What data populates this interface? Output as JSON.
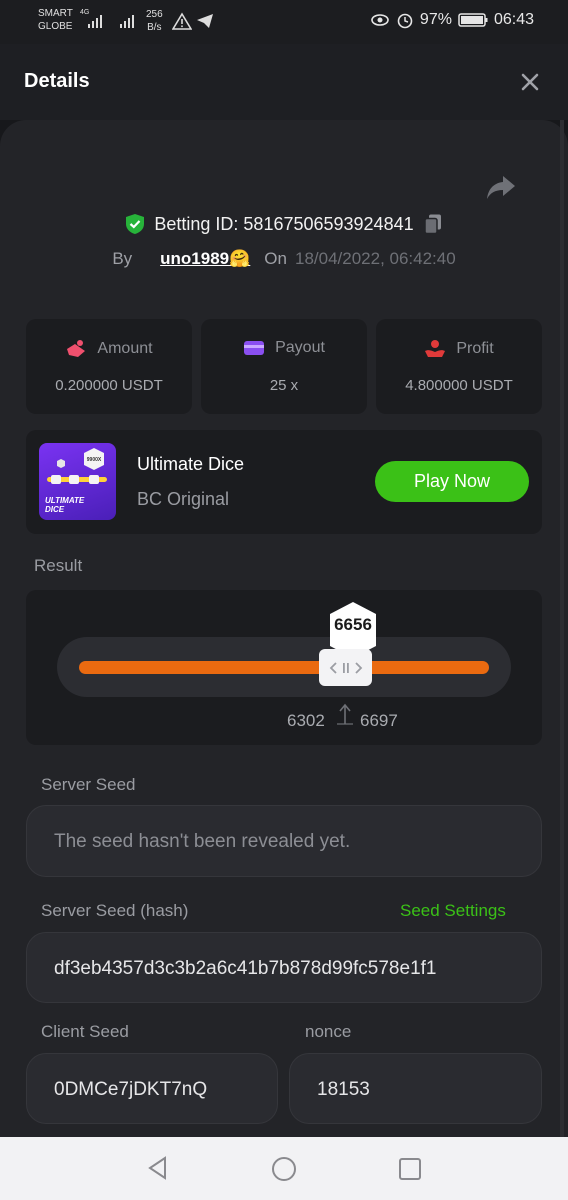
{
  "status_bar": {
    "carrier_line1": "SMART",
    "carrier_line2": "GLOBE",
    "network": "4G",
    "speed_value": "256",
    "speed_unit": "B/s",
    "battery": "97%",
    "time": "06:43"
  },
  "header": {
    "title": "Details"
  },
  "bet": {
    "betting_id_label": "Betting ID: 58167506593924841",
    "by_label": "By",
    "username": "uno1989🤗",
    "on_label": "On",
    "datetime": "18/04/2022, 06:42:40"
  },
  "stats": [
    {
      "label": "Amount",
      "value": "0.200000 USDT",
      "icon": "amount-icon"
    },
    {
      "label": "Payout",
      "value": "25 x",
      "icon": "wallet-icon"
    },
    {
      "label": "Profit",
      "value": "4.800000 USDT",
      "icon": "profit-icon"
    }
  ],
  "game": {
    "name": "Ultimate Dice",
    "subtitle": "BC Original",
    "play_label": "Play Now",
    "thumb_badge": "9900X",
    "thumb_title_line1": "ULTIMATE",
    "thumb_title_line2": "DICE"
  },
  "result": {
    "label": "Result",
    "roll": "6656",
    "range_low": "6302",
    "range_high": "6697",
    "accent_color": "#ea6a10"
  },
  "server_seed": {
    "label": "Server Seed",
    "value": "The seed hasn't been revealed yet."
  },
  "server_seed_hash": {
    "label": "Server Seed (hash)",
    "link": "Seed Settings",
    "value": "df3eb4357d3c3b2a6c41b7b878d99fc578e1f1"
  },
  "client_seed": {
    "label": "Client Seed",
    "value": "0DMCe7jDKT7nQ"
  },
  "nonce": {
    "label": "nonce",
    "value": "18153"
  },
  "colors": {
    "green": "#3bc117",
    "orange": "#ea6a10",
    "background": "#17181b"
  }
}
